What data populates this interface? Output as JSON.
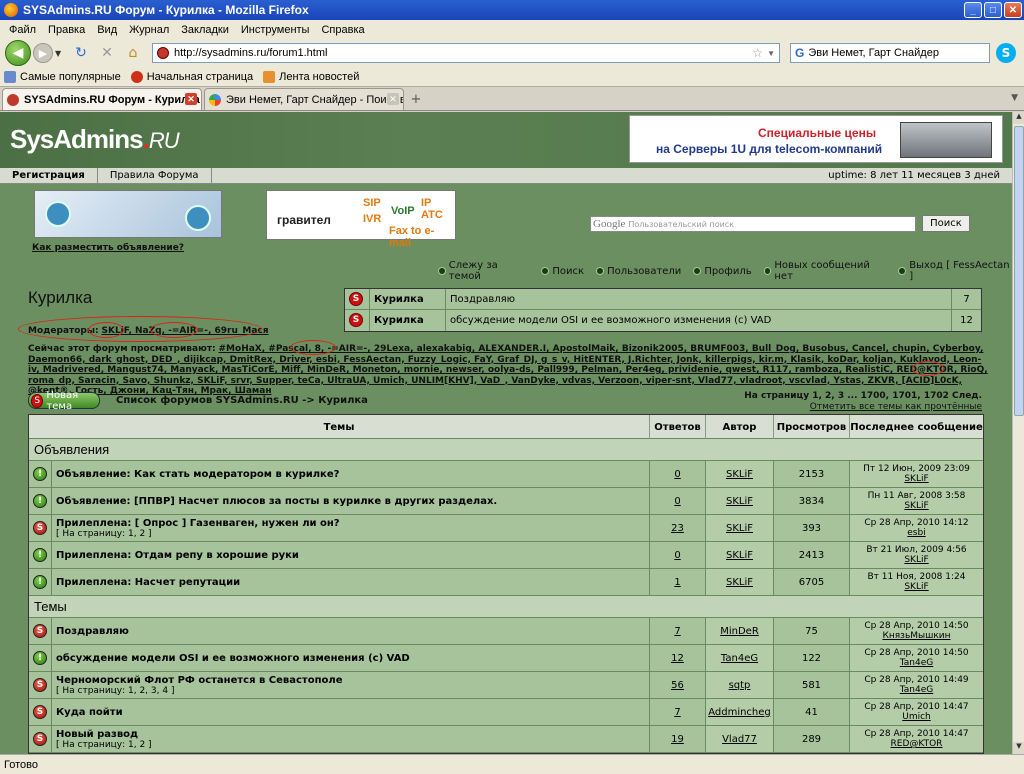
{
  "window": {
    "title": "SYSAdmins.RU Форум - Курилка - Mozilla Firefox",
    "min": "_",
    "max": "□",
    "close": "✕"
  },
  "menu": [
    "Файл",
    "Правка",
    "Вид",
    "Журнал",
    "Закладки",
    "Инструменты",
    "Справка"
  ],
  "nav": {
    "url": "http://sysadmins.ru/forum1.html",
    "search_value": "Эви Немет, Гарт Снайдер",
    "search_engine": "G"
  },
  "bookmarks": [
    "Самые популярные",
    "Начальная страница",
    "Лента новостей"
  ],
  "tabs": [
    {
      "label": "SYSAdmins.RU Форум - Курилка",
      "active": true
    },
    {
      "label": "Эви Немет, Гарт Снайдер - Поиск в ...",
      "active": false
    }
  ],
  "status": "Готово",
  "site": {
    "logo_main": "SysAdmins",
    "logo_dot": ".",
    "logo_ru": "RU",
    "ad": {
      "line1": "Специальные цены",
      "line2": "на Серверы 1U для telecom-компаний"
    },
    "subnav": [
      "Регистрация",
      "Правила Форума"
    ],
    "uptime": "uptime: 8 лет 11 месяцев 3 дней",
    "banner1_caption": "Как разместить объявление?",
    "banner2": {
      "brand": "гравител",
      "sip": "SIP",
      "voip": "VoIP",
      "ipatc": "IP ATC",
      "ivr": "IVR",
      "fax": "Fax to e-mail"
    },
    "google_placeholder": "Пользовательский поиск",
    "google_logo": "Google",
    "google_button": "Поиск",
    "topmenu": [
      "Слежу за темой",
      "Поиск",
      "Пользователи",
      "Профиль",
      "Новых сообщений нет",
      "Выход [ FessAectan ]"
    ]
  },
  "forum": {
    "title": "Курилка",
    "mods_label": "Модераторы:",
    "mods": "SKLiF, NaZq, -=AIR=-, 69ru_Мася",
    "viewers_label": "Сейчас этот форум просматривают:",
    "viewers": "#MoHaX, #Pascal, 8, -=AIR=-, 29Lexa, alexakabig, ALEXANDER.I, ApostolMaik, Bizonik2005, BRUMF003, Bull_Dog, Busobus, Cancel, chupin, Cyberboy, Daemon66, dark_ghost, DED_, dijikcap, DmitRex, Driver, esbi, FessAectan, Fuzzy_Logic, FaY, Graf_DJ, g_s_v, HitENTER, J.Richter, Jonk, killerpigs, kir.m, Klasik, koDar, koljan, Kuklavod, Leon-iv, Madrivered, Mangust74, Manyack, MasTiCorE, Miff, MinDeR, Moneton, mornie, newser, oolya-ds, Pall999, Pelman, Per4eg, prividenie, qwest, R117, ramboza, RealistiC, RED@KTOR, RioQ, roma_dp, Saracin, Savo, Shunkz, SKLiF, srvr, Supper, teCa, UltraUA, Umich, UNLIM[KHV], VaD_, VanDyke, vdvas, Verzoon, viper-snt, Vlad77, vladroot, vscvlad, Ystas, ZKVR, [ACID]L0cK, @kent®, Гость, Джони, Кац-Тян, Мрак, Шаман",
    "new_topic": "Новая тема",
    "breadcrumb": "Список форумов SYSAdmins.RU -> Курилка",
    "pages_line": "На страницу 1, 2, 3 ... 1700, 1701, 1702  След.",
    "mark_read": "Отметить все темы как прочтённые",
    "mini_table": [
      {
        "forum": "Курилка",
        "topic": "Поздравляю",
        "count": "7"
      },
      {
        "forum": "Курилка",
        "topic": "обсуждение модели OSI и ее возможного изменения (c) VAD",
        "count": "12"
      }
    ],
    "headers": {
      "topics": "Темы",
      "replies": "Ответов",
      "author": "Автор",
      "views": "Просмотров",
      "last": "Последнее сообщение"
    },
    "section_announcements": "Объявления",
    "section_topics": "Темы",
    "announcements": [
      {
        "icon": "g",
        "title": "Объявление: Как стать модератором в курилке?",
        "pages": "",
        "replies": "0",
        "author": "SKLiF",
        "views": "2153",
        "last_date": "Пт 12 Июн, 2009 23:09",
        "last_user": "SKLiF"
      },
      {
        "icon": "g",
        "title": "Объявление: [ППВР] Насчет плюсов за посты в курилке в других разделах.",
        "pages": "",
        "replies": "0",
        "author": "SKLiF",
        "views": "3834",
        "last_date": "Пн 11 Авг, 2008 3:58",
        "last_user": "SKLiF"
      },
      {
        "icon": "r",
        "title": "Прилеплена: [ Опрос ] Газенваген, нужен ли он?",
        "pages": "[ На страницу: 1, 2 ]",
        "replies": "23",
        "author": "SKLiF",
        "views": "393",
        "last_date": "Ср 28 Апр, 2010 14:12",
        "last_user": "esbi"
      },
      {
        "icon": "g",
        "title": "Прилеплена: Отдам репу в хорошие руки",
        "pages": "",
        "replies": "0",
        "author": "SKLiF",
        "views": "2413",
        "last_date": "Вт 21 Июл, 2009 4:56",
        "last_user": "SKLiF"
      },
      {
        "icon": "g",
        "title": "Прилеплена: Насчет репутации",
        "pages": "",
        "replies": "1",
        "author": "SKLiF",
        "views": "6705",
        "last_date": "Вт 11 Ноя, 2008 1:24",
        "last_user": "SKLiF"
      }
    ],
    "topics": [
      {
        "icon": "r",
        "title": "Поздравляю",
        "pages": "",
        "replies": "7",
        "author": "MinDeR",
        "views": "75",
        "last_date": "Ср 28 Апр, 2010 14:50",
        "last_user": "КнязьМышкин"
      },
      {
        "icon": "g",
        "title": "обсуждение модели OSI и ее возможного изменения (c) VAD",
        "pages": "",
        "replies": "12",
        "author": "Tan4eG",
        "views": "122",
        "last_date": "Ср 28 Апр, 2010 14:50",
        "last_user": "Tan4eG"
      },
      {
        "icon": "r",
        "title": "Черноморский Флот РФ останется в Севастополе",
        "pages": "[ На страницу: 1, 2, 3, 4 ]",
        "replies": "56",
        "author": "sqtp",
        "views": "581",
        "last_date": "Ср 28 Апр, 2010 14:49",
        "last_user": "Tan4eG"
      },
      {
        "icon": "r",
        "title": "Куда пойти",
        "pages": "",
        "replies": "7",
        "author": "Addmincheg",
        "views": "41",
        "last_date": "Ср 28 Апр, 2010 14:47",
        "last_user": "Umich"
      },
      {
        "icon": "r",
        "title": "Новый развод",
        "pages": "[ На страницу: 1, 2 ]",
        "replies": "19",
        "author": "Vlad77",
        "views": "289",
        "last_date": "Ср 28 Апр, 2010 14:47",
        "last_user": "RED@KTOR"
      }
    ]
  }
}
